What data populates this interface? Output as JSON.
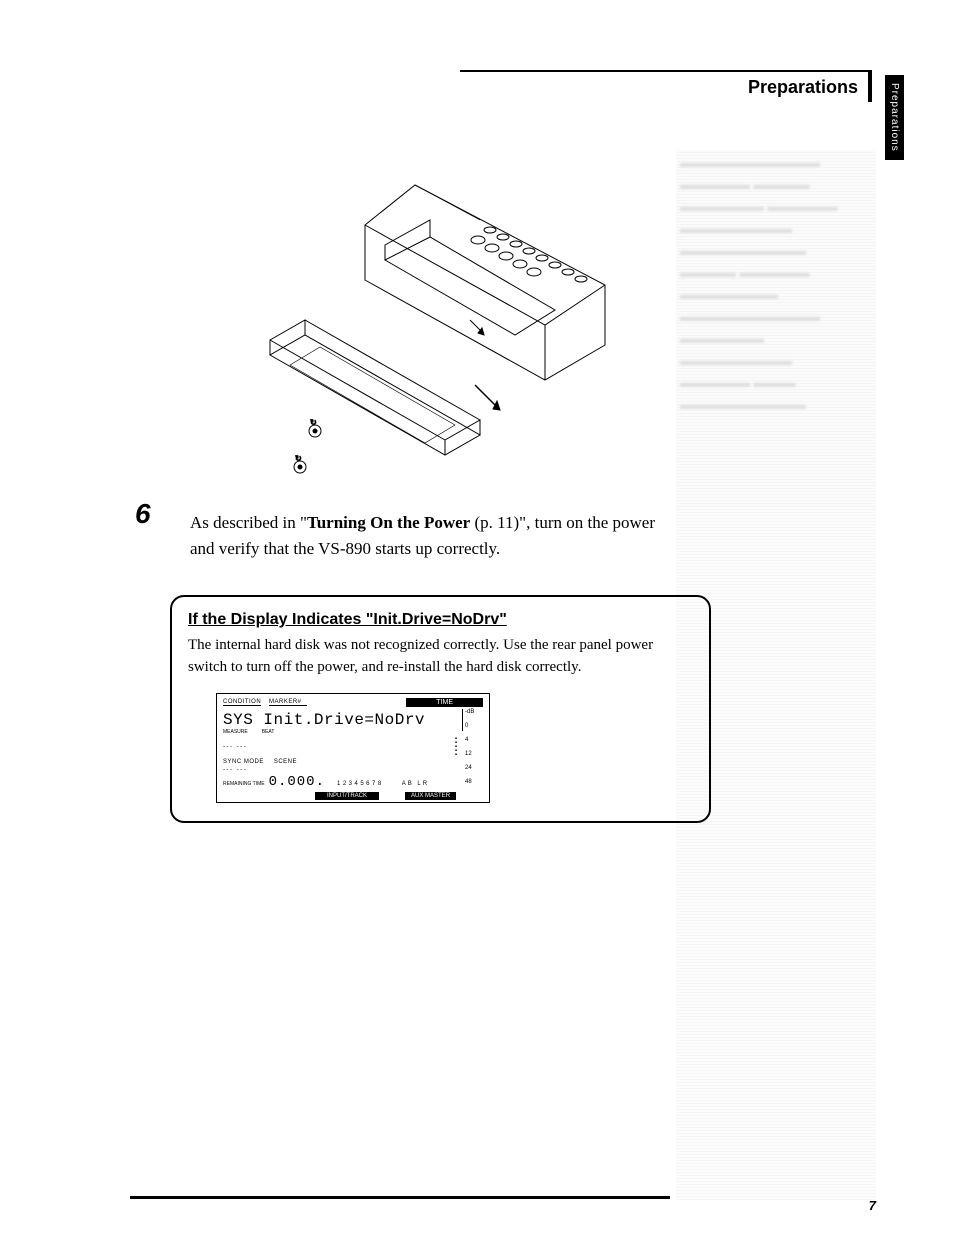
{
  "header": {
    "title": "Preparations",
    "side_tab": "Preparations"
  },
  "step": {
    "number": "6",
    "text_before_bold": "As described in \"",
    "bold": "Turning On the Power",
    "text_after_bold": " (p. 11)\", turn on the power and verify that the VS-890 starts up correctly."
  },
  "note": {
    "heading": "If the Display Indicates \"Init.Drive=NoDrv\"",
    "body": "The internal hard disk was not recognized correctly. Use the rear panel power switch to turn off the power, and re-install the hard disk correctly."
  },
  "lcd": {
    "top_labels": {
      "condition": "CONDITION",
      "marker": "MARKER#",
      "time": "TIME"
    },
    "message": "SYS Init.Drive=NoDrv",
    "small_labels": {
      "measure": "MEASURE",
      "beat": "BEAT"
    },
    "row_labels": {
      "sync_mode": "SYNC MODE",
      "scene": "SCENE"
    },
    "dashes_a": "--- ---",
    "dashes_b": "--- ---",
    "remaining_label": "REMAINING TIME",
    "remaining_value": "0.000.",
    "track_numbers": "12345678",
    "ab_lr": "AB  LR",
    "scale": [
      "-dB",
      "0",
      "4",
      "12",
      "24",
      "48"
    ],
    "input_track": "INPUT/TRACK",
    "aux_master": "AUX MASTER"
  },
  "page_number": "7"
}
